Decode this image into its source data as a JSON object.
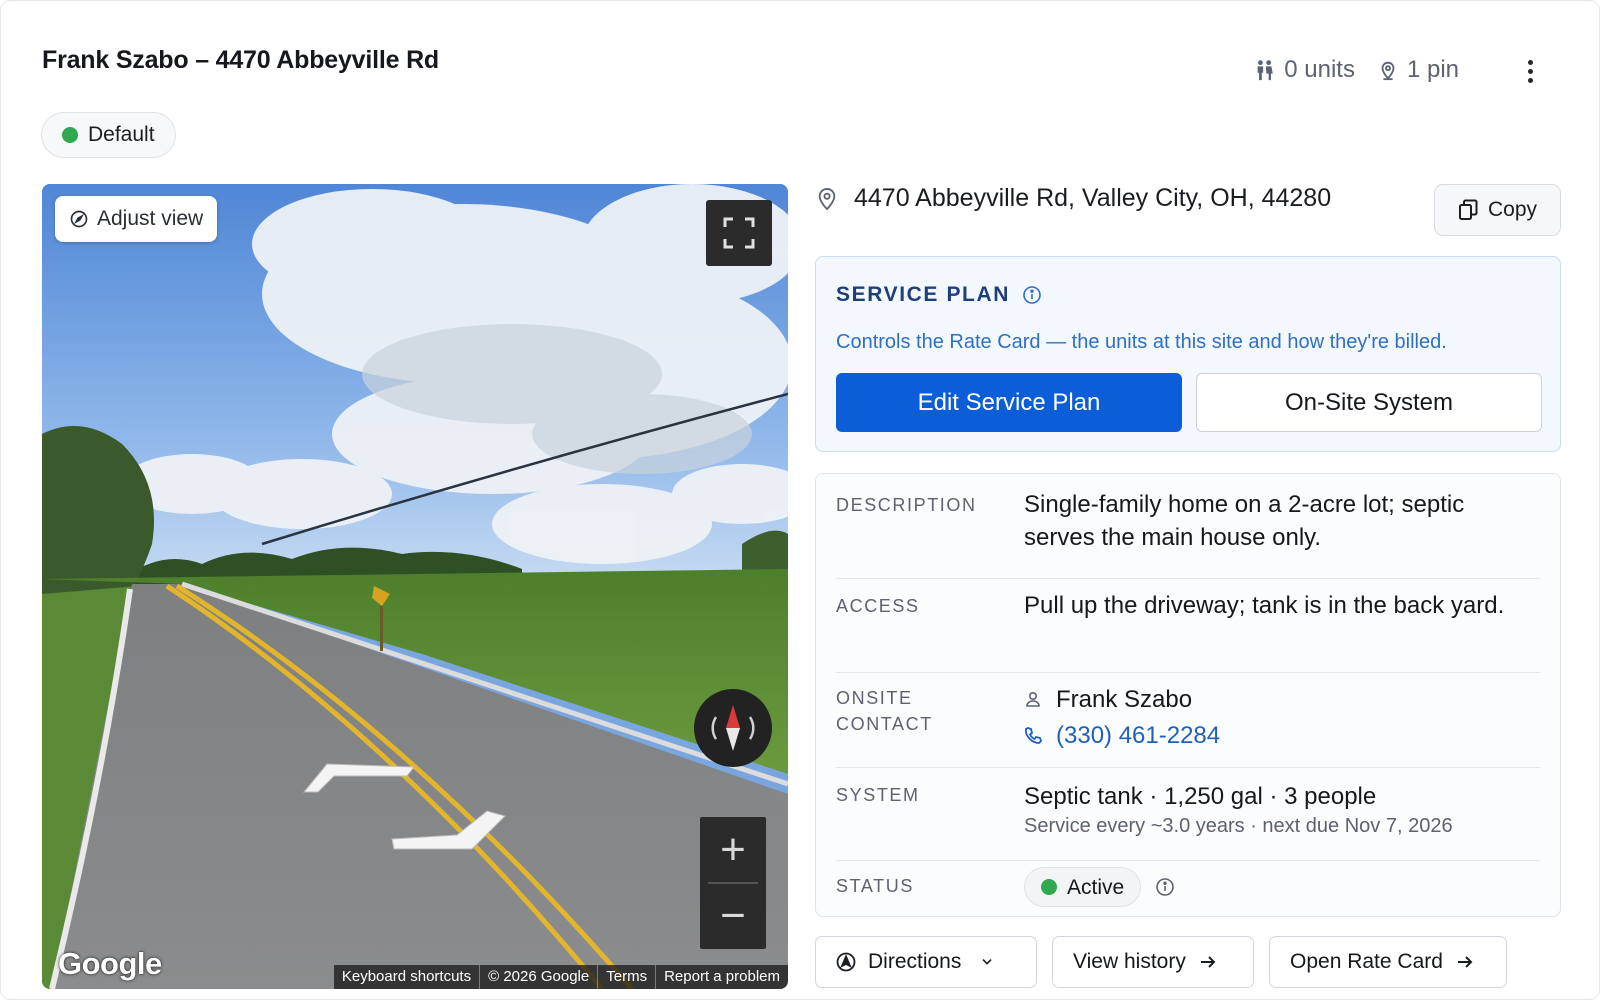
{
  "header": {
    "title": "Frank Szabo – 4470 Abbeyville Rd",
    "units": "0 units",
    "pins": "1 pin",
    "units_icon": "people-icon",
    "pins_icon": "map-pin-icon",
    "more_icon": "more-vertical-icon"
  },
  "tag": {
    "label": "Default",
    "color": "#2fa84f"
  },
  "street_view": {
    "adjust_label": "Adjust view",
    "logo": "Google",
    "footer": [
      "Keyboard shortcuts",
      "© 2026 Google",
      "Terms",
      "Report a problem"
    ],
    "zoom_in": "+",
    "zoom_out": "−"
  },
  "address": {
    "text": "4470 Abbeyville Rd, Valley City, OH, 44280",
    "copy_label": "Copy"
  },
  "service_plan": {
    "heading": "SERVICE PLAN",
    "description": "Controls the Rate Card — the units at this site and how they're billed.",
    "primary_button": "Edit Service Plan",
    "secondary_button": "On-Site System",
    "accent": "#0b5ed7"
  },
  "details": {
    "description_label": "DESCRIPTION",
    "description_value": "Single-family home on a 2-acre lot; septic serves the main house only.",
    "access_label": "ACCESS",
    "access_value": "Pull up the driveway; tank is in the back yard.",
    "contact_label": "ONSITE CONTACT",
    "contact_name": "Frank Szabo",
    "contact_phone": "(330) 461-2284",
    "system_label": "SYSTEM",
    "system_value": "Septic tank · 1,250 gal · 3 people",
    "system_sub": "Service every ~3.0 years · next due Nov 7, 2026",
    "status_label": "STATUS",
    "status_value": "Active",
    "status_color": "#2fa84f"
  },
  "actions": {
    "directions": "Directions",
    "history": "View history",
    "rate_card": "Open Rate Card"
  }
}
